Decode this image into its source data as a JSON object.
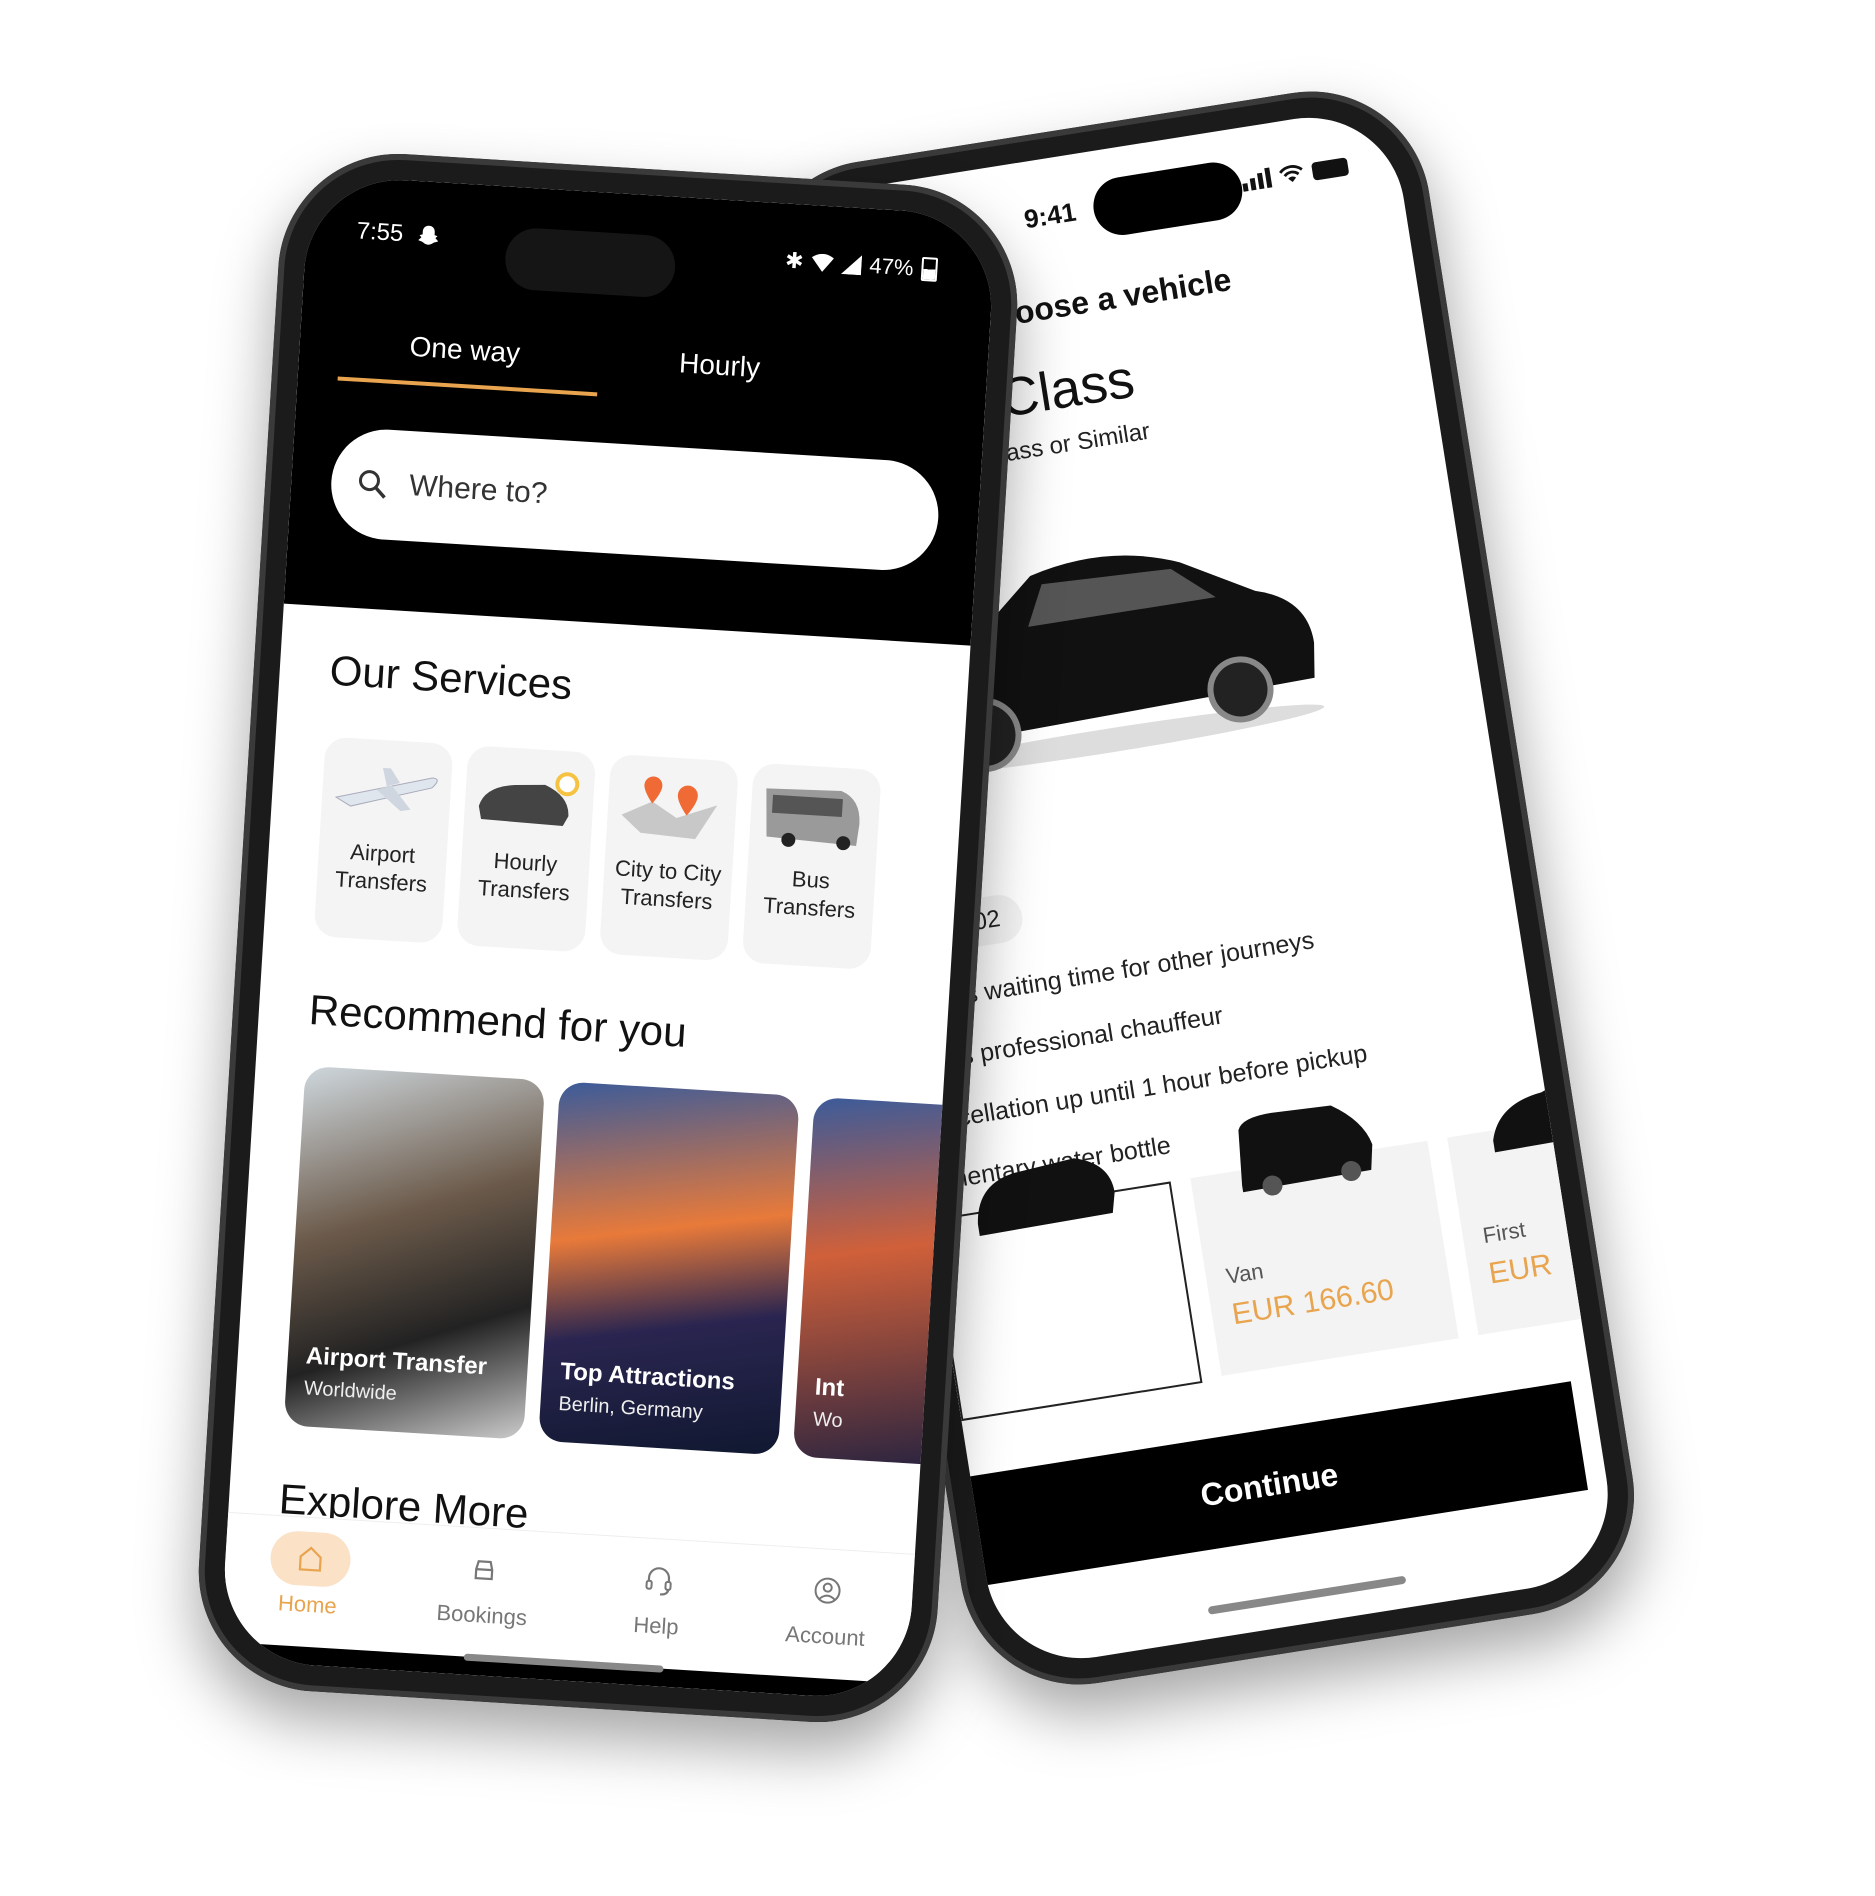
{
  "colors": {
    "accent": "#e8a44e",
    "accent_soft": "#fbe1c6",
    "dark": "#000000"
  },
  "right_phone": {
    "status": {
      "time": "9:41"
    },
    "title": "Choose a vehicle",
    "class_name": "siness Class",
    "class_subtitle": "edes Benz E Class or Similar",
    "luggage": {
      "icon": "luggage-icon",
      "count": "02"
    },
    "features": [
      "mins waiting time for other journeys",
      "ass professional chauffeur",
      "ncellation up until 1 hour before pickup",
      "nentary water bottle"
    ],
    "vehicles": [
      {
        "name": "",
        "price": "",
        "selected": true
      },
      {
        "name": "Van",
        "price": "EUR 166.60",
        "selected": false
      },
      {
        "name": "First",
        "price": "EUR",
        "selected": false
      }
    ],
    "continue_label": "Continue"
  },
  "left_phone": {
    "status": {
      "time": "7:55",
      "battery": "47%"
    },
    "tabs": [
      {
        "label": "One way",
        "active": true
      },
      {
        "label": "Hourly",
        "active": false
      }
    ],
    "search": {
      "placeholder": "Where to?"
    },
    "services_title": "Our Services",
    "services": [
      {
        "line1": "Airport",
        "line2": "Transfers",
        "icon": "airplane-icon"
      },
      {
        "line1": "Hourly",
        "line2": "Transfers",
        "icon": "car-clock-icon"
      },
      {
        "line1": "City to City",
        "line2": "Transfers",
        "icon": "map-pin-icon"
      },
      {
        "line1": "Bus",
        "line2": "Transfers",
        "icon": "bus-icon"
      }
    ],
    "recommend_title": "Recommend for you",
    "recommendations": [
      {
        "title": "Airport Transfer",
        "subtitle": "Worldwide"
      },
      {
        "title": "Top Attractions",
        "subtitle": "Berlin, Germany"
      },
      {
        "title": "Int",
        "subtitle": "Wo"
      }
    ],
    "explore_title": "Explore More",
    "nav": [
      {
        "label": "Home",
        "icon": "home-icon",
        "active": true
      },
      {
        "label": "Bookings",
        "icon": "car-icon",
        "active": false
      },
      {
        "label": "Help",
        "icon": "headset-icon",
        "active": false
      },
      {
        "label": "Account",
        "icon": "user-circle-icon",
        "active": false
      }
    ]
  }
}
